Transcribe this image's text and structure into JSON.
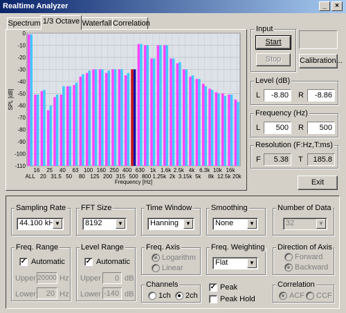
{
  "window": {
    "title": "Realtime Analyzer",
    "min_icon": "minimize-icon",
    "close_icon": "close-icon"
  },
  "tabs": [
    {
      "label": "Spectrum"
    },
    {
      "label": "1/3 Octave",
      "active": true
    },
    {
      "label": "Waterfall"
    },
    {
      "label": "Correlation"
    }
  ],
  "colors": {
    "bar_left": "#ff44ff",
    "bar_right": "#44c8ff",
    "marker_left": "#cc1111",
    "marker_right": "#1111aa"
  },
  "chart_data": {
    "type": "bar",
    "ylabel": "SPL [dB]",
    "xlabel": "Frequency [Hz]",
    "ylim": [
      -110,
      0
    ],
    "yticks": [
      "0",
      "-10",
      "-20",
      "-30",
      "-40",
      "-50",
      "-60",
      "-70",
      "-80",
      "-90",
      "-100",
      "-110"
    ],
    "xticks_top": [
      "16",
      "25",
      "40",
      "63",
      "100",
      "160",
      "250",
      "400",
      "630",
      "1k",
      "1.6k",
      "2.5k",
      "4k",
      "6.3k",
      "10k",
      "16k"
    ],
    "xticks_bottom": [
      "ALL",
      "20",
      "31.5",
      "50",
      "80",
      "125",
      "200",
      "315",
      "500",
      "800",
      "1.25k",
      "2k",
      "3.15k",
      "5k",
      "8k",
      "12.5k",
      "20k"
    ],
    "categories": [
      "ALL",
      "16",
      "20",
      "25",
      "31.5",
      "40",
      "50",
      "63",
      "80",
      "100",
      "125",
      "160",
      "200",
      "250",
      "315",
      "400",
      "500",
      "630",
      "800",
      "1k",
      "1.25k",
      "1.6k",
      "2k",
      "2.5k",
      "3.15k",
      "4k",
      "5k",
      "6.3k",
      "8k",
      "10k",
      "12.5k",
      "16k",
      "20k"
    ],
    "series": [
      {
        "name": "L",
        "values": [
          -1,
          -51,
          -48,
          -64,
          -53,
          -51,
          -44,
          -43,
          -36,
          -33,
          -30,
          -30,
          -33,
          -30,
          -30,
          -35,
          -30,
          -9,
          -10,
          -21,
          -10,
          -10,
          -21,
          -25,
          -30,
          -36,
          -38,
          -42,
          -46,
          -49,
          -50,
          -51,
          -55
        ]
      },
      {
        "name": "R",
        "values": [
          -1,
          -51,
          -47,
          -60,
          -51,
          -44,
          -44,
          -41,
          -34,
          -31,
          -30,
          -30,
          -31,
          -30,
          -30,
          -33,
          -30,
          -9,
          -10,
          -21,
          -10,
          -10,
          -21,
          -24,
          -30,
          -35,
          -38,
          -44,
          -47,
          -50,
          -52,
          -51,
          -57
        ]
      }
    ],
    "marker_index": 16
  },
  "input": {
    "group": "Input",
    "start": "Start",
    "stop": "Stop",
    "calibration": "Calibration..."
  },
  "level": {
    "group": "Level (dB)",
    "l_label": "L",
    "l_value": "-8.80",
    "r_label": "R",
    "r_value": "-8.86"
  },
  "frequency": {
    "group": "Frequency (Hz)",
    "l_label": "L",
    "l_value": "500",
    "r_label": "R",
    "r_value": "500"
  },
  "resolution": {
    "group": "Resolution (F:Hz,T:ms)",
    "f_label": "F",
    "f_value": "5.38",
    "t_label": "T",
    "t_value": "185.8"
  },
  "exit": "Exit",
  "sampling_rate": {
    "group": "Sampling Rate",
    "value": "44.100 kHz"
  },
  "fft_size": {
    "group": "FFT Size",
    "value": "8192"
  },
  "time_window": {
    "group": "Time Window",
    "value": "Hanning"
  },
  "smoothing": {
    "group": "Smoothing",
    "value": "None"
  },
  "number_of_data": {
    "group": "Number of Data",
    "value": "32"
  },
  "freq_range": {
    "group": "Freq. Range",
    "automatic": "Automatic",
    "upper_label": "Upper",
    "upper": "20000",
    "upper_unit": "Hz",
    "lower_label": "Lower",
    "lower": "20",
    "lower_unit": "Hz"
  },
  "level_range": {
    "group": "Level Range",
    "automatic": "Automatic",
    "upper_label": "Upper",
    "upper": "0",
    "upper_unit": "dB",
    "lower_label": "Lower",
    "lower": "-140",
    "lower_unit": "dB"
  },
  "freq_axis": {
    "group": "Freq. Axis",
    "log": "Logarithm",
    "linear": "Linear"
  },
  "freq_weighting": {
    "group": "Freq. Weighting",
    "value": "Flat"
  },
  "direction_of_axis": {
    "group": "Direction of Axis",
    "forward": "Forward",
    "backward": "Backward"
  },
  "channels": {
    "group": "Channels",
    "ch1": "1ch",
    "ch2": "2ch"
  },
  "peak": {
    "peak": "Peak",
    "peak_hold": "Peak Hold"
  },
  "correlation": {
    "group": "Correlation",
    "acf": "ACF",
    "ccf": "CCF"
  }
}
